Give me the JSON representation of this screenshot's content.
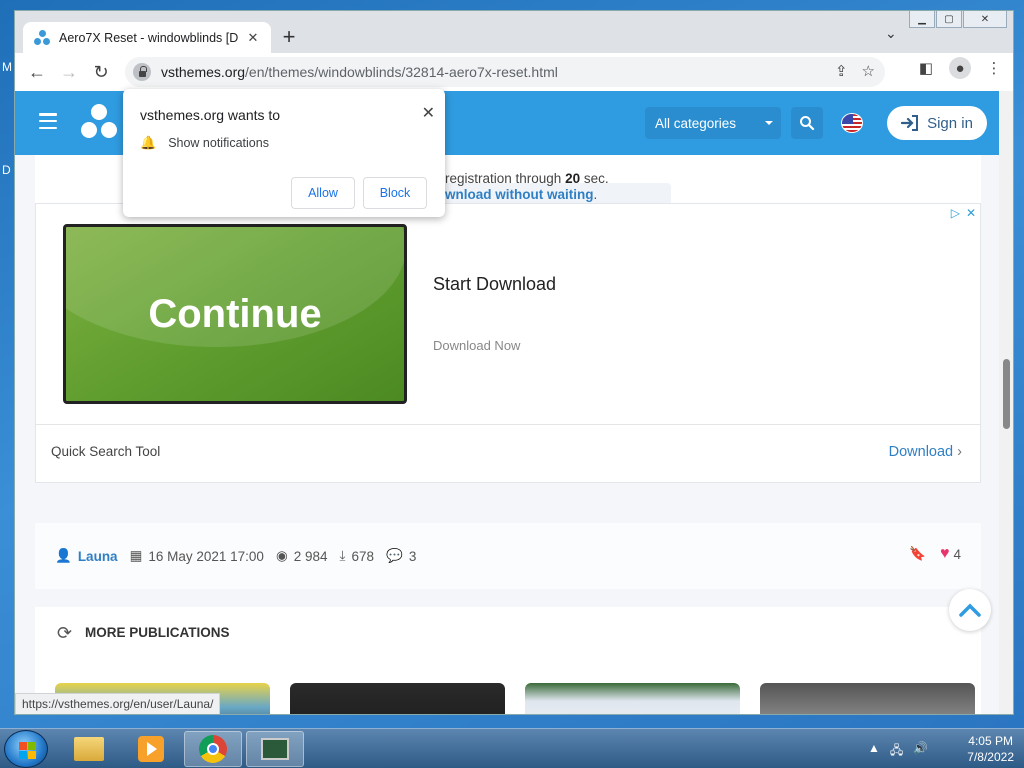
{
  "desktop": {
    "side_letters": [
      "M",
      "D"
    ]
  },
  "window": {
    "tab_title": "Aero7X Reset - windowblinds [D",
    "new_tab_label": "+",
    "controls": [
      "minimize",
      "maximize",
      "close"
    ]
  },
  "toolbar": {
    "url_host": "vsthemes.org",
    "url_path": "/en/themes/windowblinds/32814-aero7x-reset.html"
  },
  "site": {
    "category_label": "All categories",
    "signin_label": "Sign in",
    "registration_text": "registration through",
    "registration_seconds": "20",
    "registration_unit": "sec.",
    "download_link": "wnload without waiting",
    "download_link_tail": "."
  },
  "ad": {
    "image_text": "Continue",
    "title": "Start Download",
    "subtitle": "Download Now",
    "footer_left": "Quick Search Tool",
    "footer_right": "Download",
    "accent": "#2f7fc5"
  },
  "meta": {
    "author": "Launa",
    "date": "16 May 2021 17:00",
    "views": "2 984",
    "downloads": "678",
    "comments": "3",
    "likes": "4"
  },
  "more": {
    "title": "MORE PUBLICATIONS"
  },
  "statusbar": {
    "text": "https://vsthemes.org/en/user/Launa/"
  },
  "popup": {
    "title": "vsthemes.org wants to",
    "permission": "Show notifications",
    "allow_label": "Allow",
    "block_label": "Block"
  },
  "taskbar": {
    "time": "4:05 PM",
    "date": "7/8/2022"
  },
  "colors": {
    "header": "#2f9be0",
    "like": "#e8336b",
    "taskbar": "#3c6a98"
  }
}
